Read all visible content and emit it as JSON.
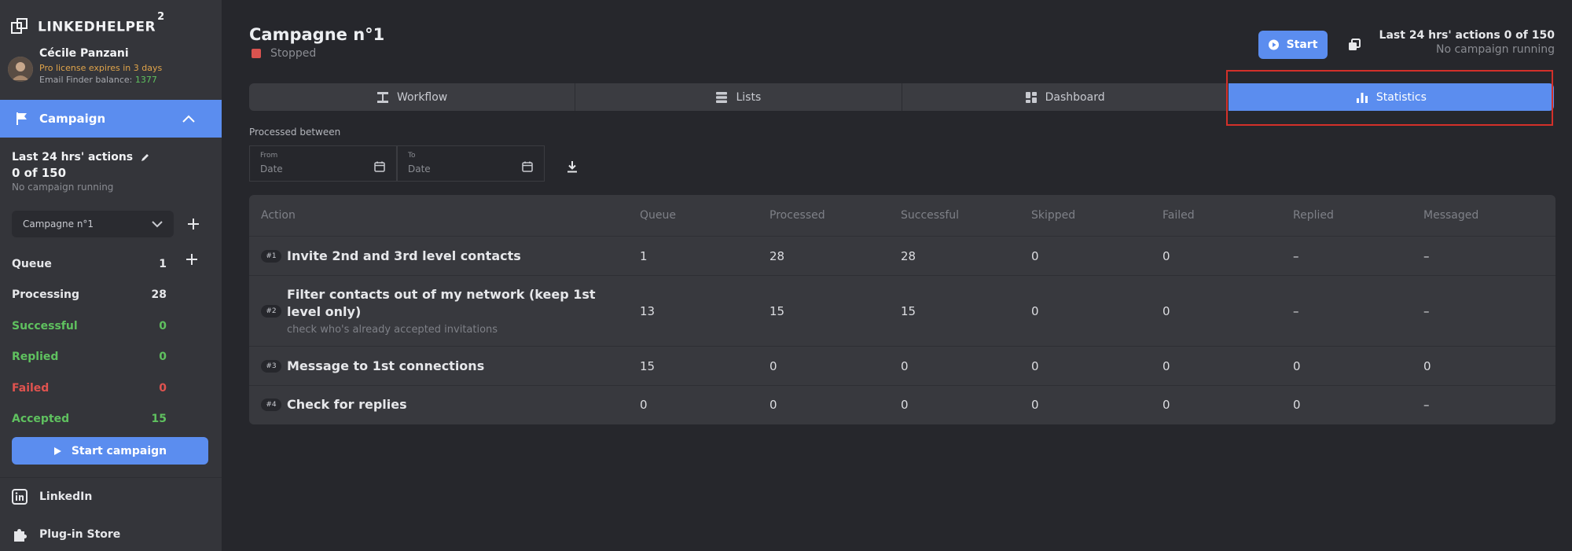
{
  "app": {
    "logo_text": "LINKEDHELPER",
    "logo_sup": "2"
  },
  "user": {
    "name": "Cécile Panzani",
    "license": "Pro license expires in 3 days",
    "balance_label": "Email Finder balance: ",
    "balance_value": "1377"
  },
  "sidebar": {
    "campaign_label": "Campaign",
    "actions_title": "Last 24 hrs' actions",
    "actions_count": "0 of 150",
    "actions_status": "No campaign running",
    "campaign_select": "Campagne n°1",
    "stats": [
      {
        "label": "Queue",
        "value": "1",
        "color": "#e6e7ea"
      },
      {
        "label": "Processing",
        "value": "28",
        "color": "#e6e7ea"
      },
      {
        "label": "Successful",
        "value": "0",
        "color": "#5fc15f"
      },
      {
        "label": "Replied",
        "value": "0",
        "color": "#5fc15f"
      },
      {
        "label": "Failed",
        "value": "0",
        "color": "#e0534f"
      },
      {
        "label": "Accepted",
        "value": "15",
        "color": "#5fc15f"
      }
    ],
    "start_campaign": "Start campaign",
    "links": [
      {
        "label": "LinkedIn",
        "icon": "linkedin-icon"
      },
      {
        "label": "Plug-in Store",
        "icon": "puzzle-icon"
      }
    ]
  },
  "main": {
    "title": "Campagne n°1",
    "status": "Stopped",
    "start_label": "Start",
    "top_right_line1": "Last 24 hrs' actions 0 of 150",
    "top_right_line2": "No campaign running",
    "tabs": [
      {
        "label": "Workflow",
        "icon": "workflow-icon"
      },
      {
        "label": "Lists",
        "icon": "list-icon"
      },
      {
        "label": "Dashboard",
        "icon": "dashboard-icon"
      },
      {
        "label": "Statistics",
        "icon": "bar-chart-icon"
      }
    ],
    "active_tab": "Statistics",
    "processed_between": "Processed between",
    "from_label": "From",
    "to_label": "To",
    "date_placeholder": "Date"
  },
  "table": {
    "headers": [
      "Action",
      "Queue",
      "Processed",
      "Successful",
      "Skipped",
      "Failed",
      "Replied",
      "Messaged"
    ],
    "rows": [
      {
        "num": "#1",
        "name": "Invite 2nd and 3rd level contacts",
        "sub": "",
        "cells": [
          "1",
          "28",
          "28",
          "0",
          "0",
          "–",
          "–"
        ]
      },
      {
        "num": "#2",
        "name": "Filter contacts out of my network (keep 1st level only)",
        "sub": "check who's already accepted invitations",
        "cells": [
          "13",
          "15",
          "15",
          "0",
          "0",
          "–",
          "–"
        ]
      },
      {
        "num": "#3",
        "name": "Message to 1st connections",
        "sub": "",
        "cells": [
          "15",
          "0",
          "0",
          "0",
          "0",
          "0",
          "0"
        ]
      },
      {
        "num": "#4",
        "name": "Check for replies",
        "sub": "",
        "cells": [
          "0",
          "0",
          "0",
          "0",
          "0",
          "0",
          "–"
        ]
      }
    ]
  },
  "colors": {
    "accent": "#5b8def",
    "success": "#5fc15f",
    "danger": "#e0534f",
    "warning": "#e0a44a",
    "highlight_border": "#d3302a"
  }
}
